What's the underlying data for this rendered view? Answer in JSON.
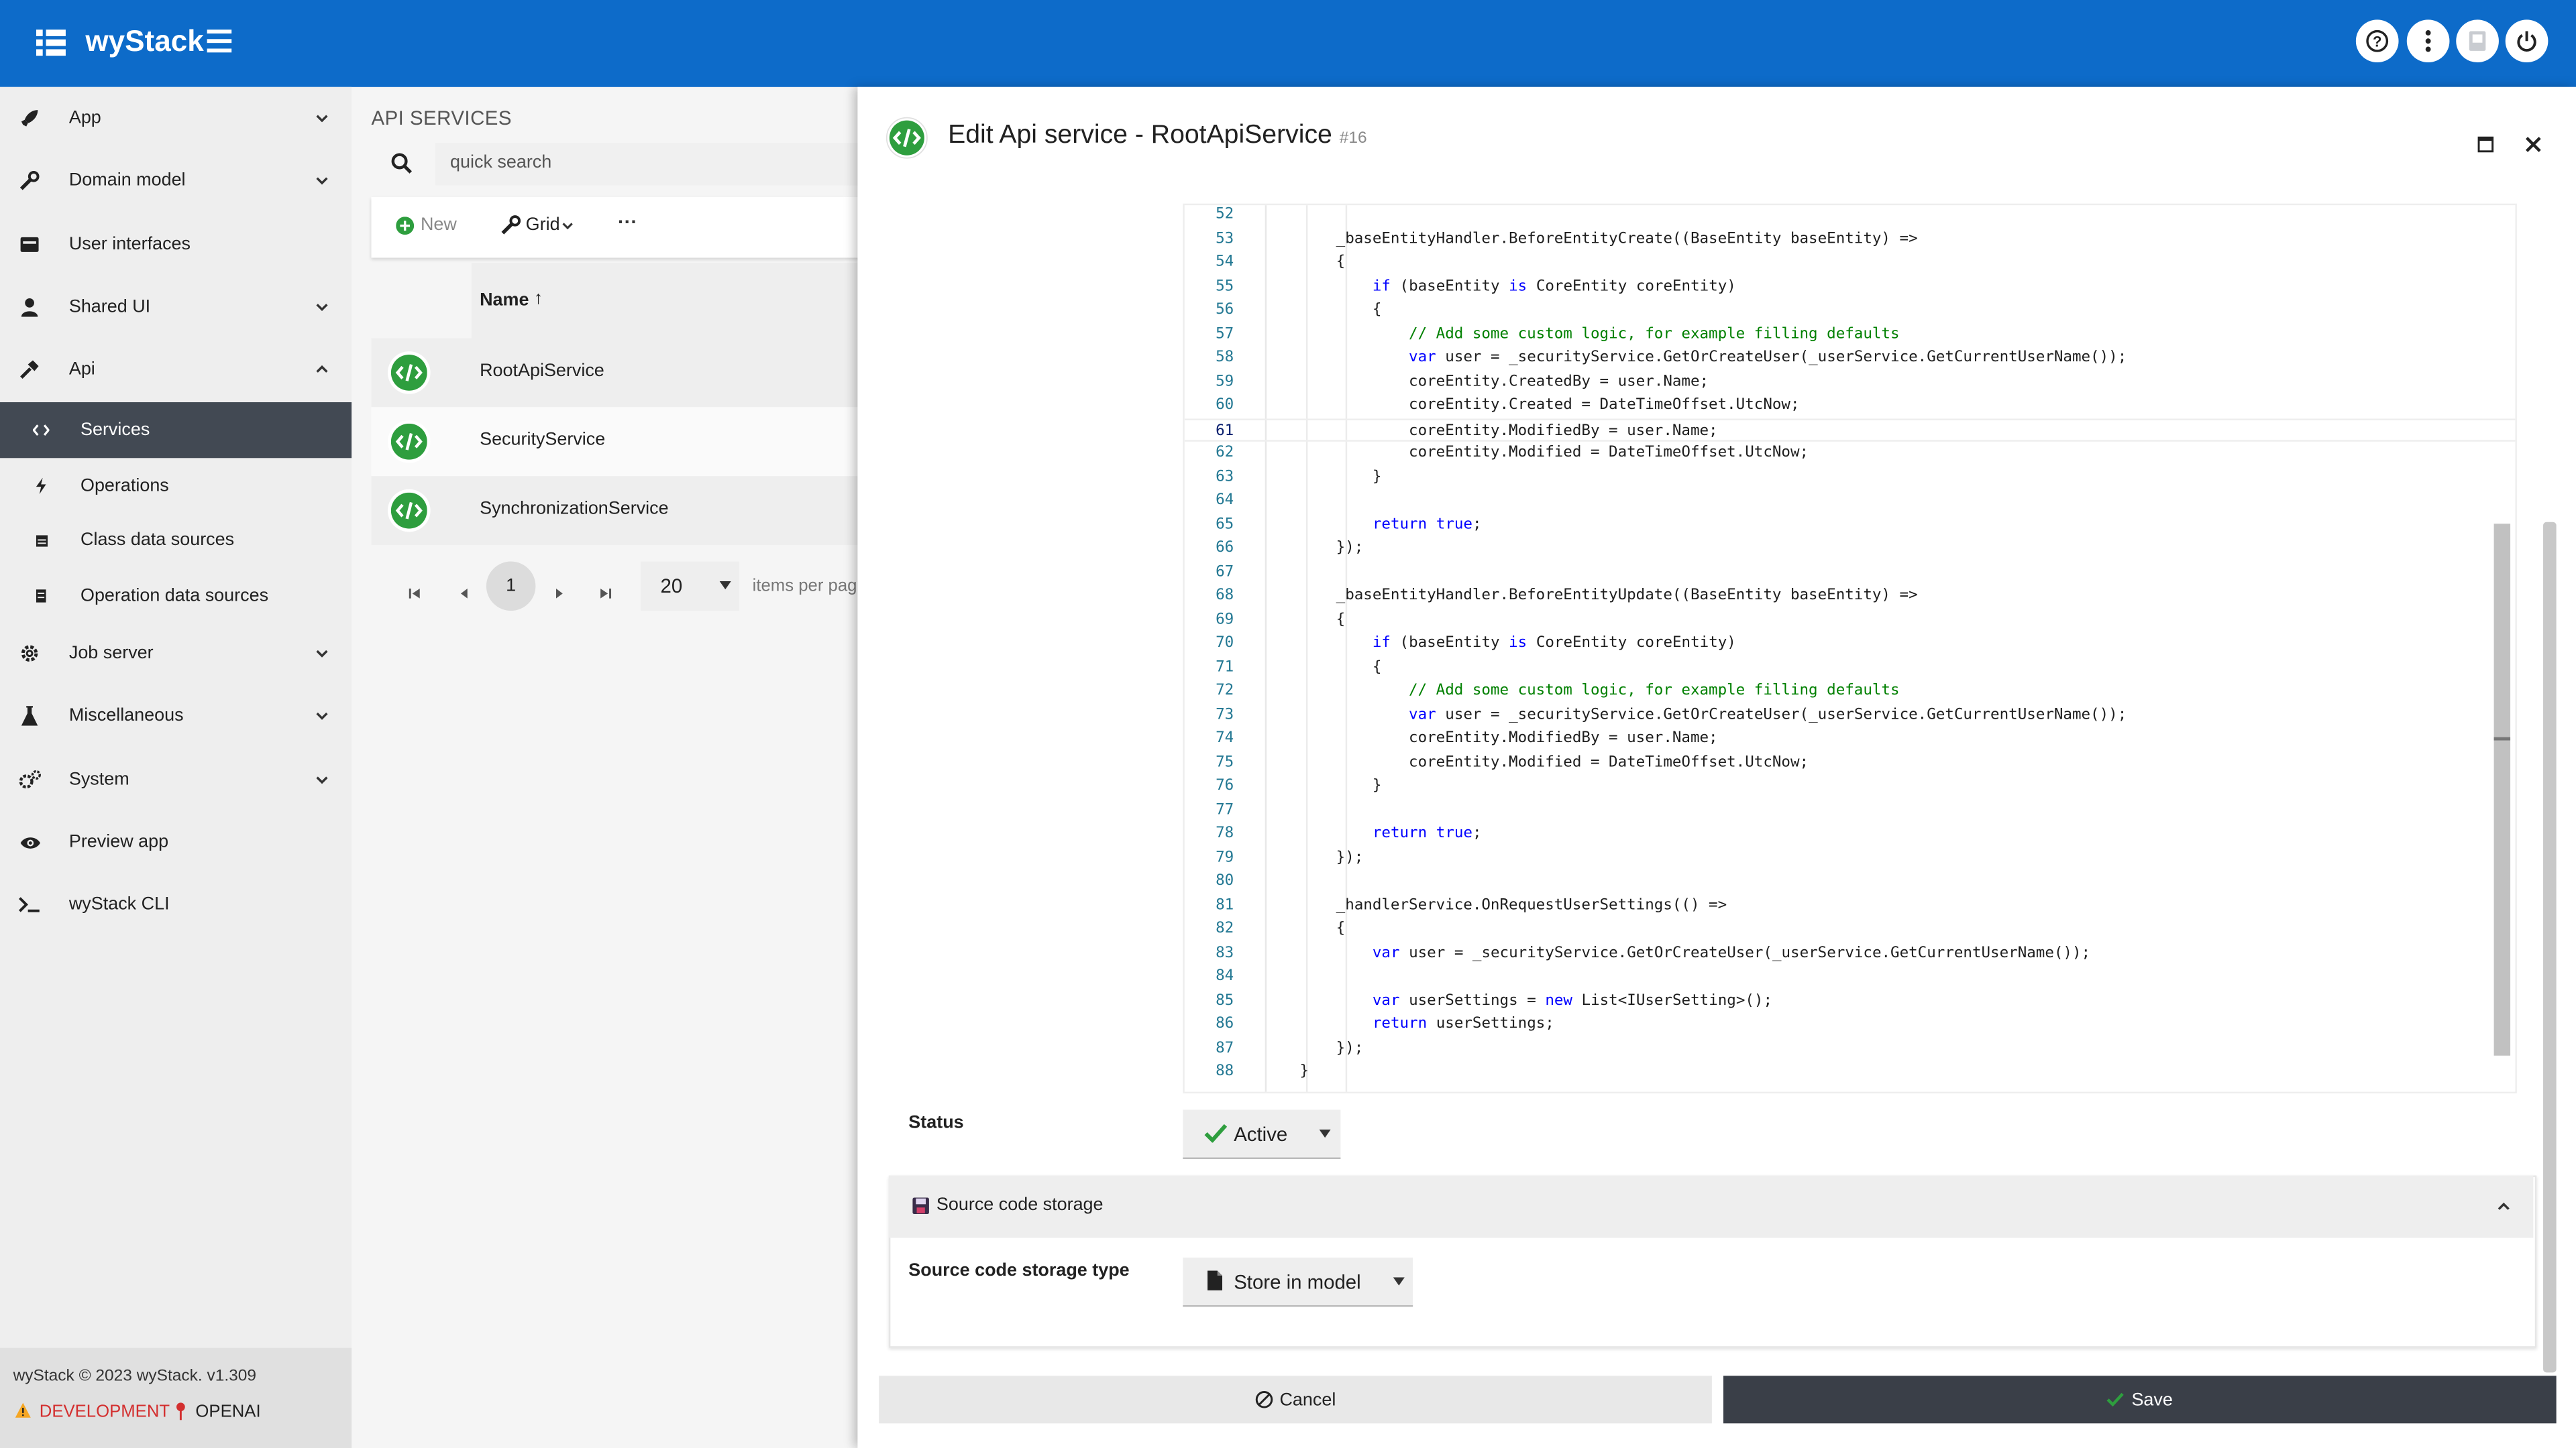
{
  "app": {
    "title": "wyStack"
  },
  "sidebar": {
    "items": [
      {
        "label": "App",
        "icon": "rocket-icon",
        "expandable": true
      },
      {
        "label": "Domain model",
        "icon": "wrench-icon",
        "expandable": true
      },
      {
        "label": "User interfaces",
        "icon": "card-icon",
        "expandable": false
      },
      {
        "label": "Shared UI",
        "icon": "person-icon",
        "expandable": true
      },
      {
        "label": "Api",
        "icon": "hammer-icon",
        "expandable": true,
        "expanded": true
      },
      {
        "label": "Job server",
        "icon": "gear-icon",
        "expandable": true
      },
      {
        "label": "Miscellaneous",
        "icon": "flask-icon",
        "expandable": true
      },
      {
        "label": "System",
        "icon": "gears-icon",
        "expandable": true
      },
      {
        "label": "Preview app",
        "icon": "eye-icon",
        "expandable": false
      },
      {
        "label": "wyStack CLI",
        "icon": "terminal-icon",
        "expandable": false
      }
    ],
    "api_sub": [
      {
        "label": "Services",
        "icon": "code-icon",
        "active": true
      },
      {
        "label": "Operations",
        "icon": "bolt-icon",
        "active": false
      },
      {
        "label": "Class data sources",
        "icon": "table-icon",
        "active": false
      },
      {
        "label": "Operation data sources",
        "icon": "list-icon",
        "active": false
      }
    ],
    "footer": {
      "copyright": "wyStack © 2023 wyStack. v1.309",
      "env": "DEVELOPMENT",
      "provider": "OPENAI"
    }
  },
  "list": {
    "title": "API SERVICES",
    "search_placeholder": "quick search",
    "new_label": "New",
    "grid_label": "Grid",
    "more_label": "···",
    "column_name": "Name",
    "sort_indicator": "↑",
    "rows": [
      {
        "name": "RootApiService"
      },
      {
        "name": "SecurityService"
      },
      {
        "name": "SynchronizationService"
      }
    ],
    "pager": {
      "page": "1",
      "per_page": "20",
      "per_page_label": "items per pag"
    }
  },
  "dialog": {
    "title": "Edit Api service - RootApiService",
    "id": "#16",
    "status_label": "Status",
    "status_value": "Active",
    "section_title": "Source code storage",
    "storage_label": "Source code storage type",
    "storage_value": "Store in model",
    "cancel_label": "Cancel",
    "save_label": "Save",
    "current_line": 61,
    "code": [
      {
        "n": "52",
        "t": ""
      },
      {
        "n": "53",
        "t": "        _baseEntityHandler.BeforeEntityCreate((BaseEntity baseEntity) =>"
      },
      {
        "n": "54",
        "t": "        {"
      },
      {
        "n": "55",
        "t": "            if (baseEntity is CoreEntity coreEntity)",
        "k": true
      },
      {
        "n": "56",
        "t": "            {"
      },
      {
        "n": "57",
        "t": "                // Add some custom logic, for example filling defaults",
        "c": true
      },
      {
        "n": "58",
        "t": "                var user = _securityService.GetOrCreateUser(_userService.GetCurrentUserName());",
        "k": true
      },
      {
        "n": "59",
        "t": "                coreEntity.CreatedBy = user.Name;"
      },
      {
        "n": "60",
        "t": "                coreEntity.Created = DateTimeOffset.UtcNow;"
      },
      {
        "n": "61",
        "t": "                coreEntity.ModifiedBy = user.Name;"
      },
      {
        "n": "62",
        "t": "                coreEntity.Modified = DateTimeOffset.UtcNow;"
      },
      {
        "n": "63",
        "t": "            }"
      },
      {
        "n": "64",
        "t": ""
      },
      {
        "n": "65",
        "t": "            return true;",
        "k": true
      },
      {
        "n": "66",
        "t": "        });"
      },
      {
        "n": "67",
        "t": ""
      },
      {
        "n": "68",
        "t": "        _baseEntityHandler.BeforeEntityUpdate((BaseEntity baseEntity) =>"
      },
      {
        "n": "69",
        "t": "        {"
      },
      {
        "n": "70",
        "t": "            if (baseEntity is CoreEntity coreEntity)",
        "k": true
      },
      {
        "n": "71",
        "t": "            {"
      },
      {
        "n": "72",
        "t": "                // Add some custom logic, for example filling defaults",
        "c": true
      },
      {
        "n": "73",
        "t": "                var user = _securityService.GetOrCreateUser(_userService.GetCurrentUserName());",
        "k": true
      },
      {
        "n": "74",
        "t": "                coreEntity.ModifiedBy = user.Name;"
      },
      {
        "n": "75",
        "t": "                coreEntity.Modified = DateTimeOffset.UtcNow;"
      },
      {
        "n": "76",
        "t": "            }"
      },
      {
        "n": "77",
        "t": ""
      },
      {
        "n": "78",
        "t": "            return true;",
        "k": true
      },
      {
        "n": "79",
        "t": "        });"
      },
      {
        "n": "80",
        "t": ""
      },
      {
        "n": "81",
        "t": "        _handlerService.OnRequestUserSettings(() =>"
      },
      {
        "n": "82",
        "t": "        {"
      },
      {
        "n": "83",
        "t": "            var user = _securityService.GetOrCreateUser(_userService.GetCurrentUserName());",
        "k": true
      },
      {
        "n": "84",
        "t": ""
      },
      {
        "n": "85",
        "t": "            var userSettings = new List<IUserSetting>();",
        "k": true
      },
      {
        "n": "86",
        "t": "            return userSettings;",
        "k": true
      },
      {
        "n": "87",
        "t": "        });"
      },
      {
        "n": "88",
        "t": "    }"
      }
    ]
  },
  "colors": {
    "primary": "#0d6bc9",
    "active_nav": "#424953",
    "save": "#3a3f48",
    "success": "#2e9e3e",
    "danger": "#d32f2f"
  }
}
